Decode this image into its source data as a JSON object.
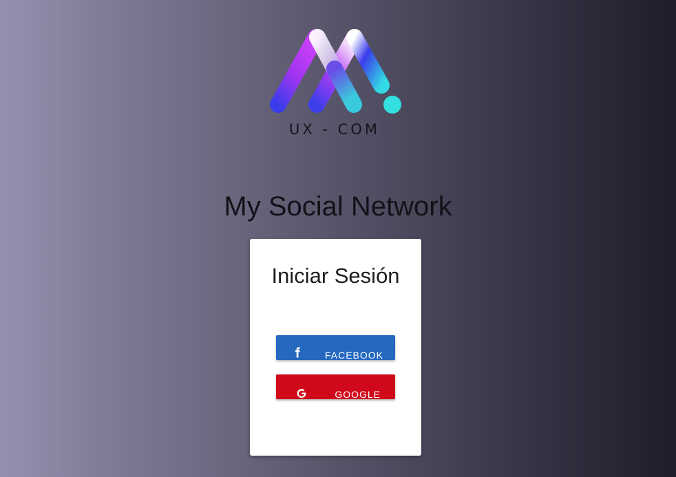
{
  "logo": {
    "text": "UX - COM",
    "icon": "ux-com-logo-mark",
    "colors": {
      "purple": "#b93cf6",
      "blue": "#3a3cea",
      "cyan": "#33e0df",
      "white": "#ffffff"
    }
  },
  "header": {
    "title": "My Social Network"
  },
  "login_card": {
    "title": "Iniciar Sesión",
    "facebook_button": {
      "label": "FACEBOOK",
      "icon": "facebook-icon",
      "color": "#2468c0"
    },
    "google_button": {
      "label": "GOOGLE",
      "icon": "google-icon",
      "color": "#d0091a"
    }
  }
}
